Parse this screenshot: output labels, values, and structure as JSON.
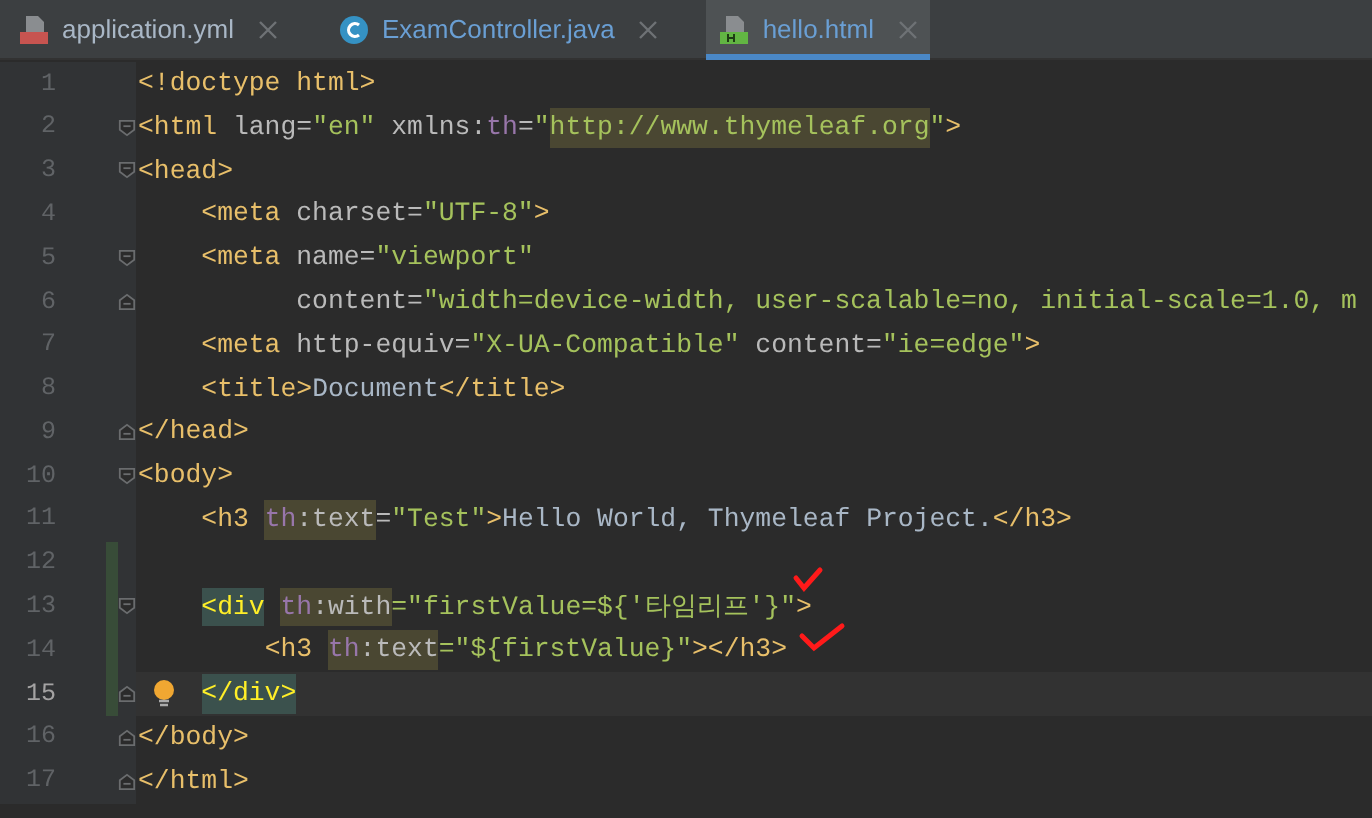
{
  "tabs": [
    {
      "label": "application.yml",
      "selected": false,
      "color": "#a9b7c6"
    },
    {
      "label": "ExamController.java",
      "selected": false,
      "color": "#6a9fd4"
    },
    {
      "label": "hello.html",
      "selected": true,
      "color": "#6a9fd4"
    }
  ],
  "editor": {
    "lines": [
      {
        "number": "1",
        "tokens": [
          {
            "kind": "tag",
            "text": "<!doctype html>"
          }
        ]
      },
      {
        "number": "2",
        "fold_start": true,
        "tokens": [
          {
            "kind": "tag",
            "text": "<html "
          },
          {
            "kind": "attr",
            "text": "lang="
          },
          {
            "kind": "value",
            "text": "\"en\" "
          },
          {
            "kind": "attr",
            "text": "xmlns:"
          },
          {
            "kind": "ns",
            "text": "th"
          },
          {
            "kind": "attr",
            "text": "="
          },
          {
            "kind": "value",
            "text": "\""
          },
          {
            "kind": "value",
            "text": "http://www.thymeleaf.org",
            "highlighted": true
          },
          {
            "kind": "value",
            "text": "\""
          },
          {
            "kind": "tag",
            "text": ">"
          }
        ]
      },
      {
        "number": "3",
        "fold_start": true,
        "tokens": [
          {
            "kind": "tag",
            "text": "<head>"
          }
        ]
      },
      {
        "number": "4",
        "tokens": [
          {
            "kind": "tag",
            "text": "    <meta "
          },
          {
            "kind": "attr",
            "text": "charset="
          },
          {
            "kind": "value",
            "text": "\"UTF-8\""
          },
          {
            "kind": "tag",
            "text": ">"
          }
        ]
      },
      {
        "number": "5",
        "fold_start": true,
        "tokens": [
          {
            "kind": "tag",
            "text": "    <meta "
          },
          {
            "kind": "attr",
            "text": "name="
          },
          {
            "kind": "value",
            "text": "\"viewport\""
          }
        ]
      },
      {
        "number": "6",
        "fold_end": true,
        "tokens": [
          {
            "kind": "attr",
            "text": "          content="
          },
          {
            "kind": "value",
            "text": "\"width=device-width, user-scalable=no, initial-scale=1.0, m"
          }
        ]
      },
      {
        "number": "7",
        "tokens": [
          {
            "kind": "tag",
            "text": "    <meta "
          },
          {
            "kind": "attr",
            "text": "http-equiv="
          },
          {
            "kind": "value",
            "text": "\"X-UA-Compatible\" "
          },
          {
            "kind": "attr",
            "text": "content="
          },
          {
            "kind": "value",
            "text": "\"ie=edge\""
          },
          {
            "kind": "tag",
            "text": ">"
          }
        ]
      },
      {
        "number": "8",
        "tokens": [
          {
            "kind": "tag",
            "text": "    <title>"
          },
          {
            "kind": "plain",
            "text": "Document"
          },
          {
            "kind": "tag",
            "text": "</title>"
          }
        ]
      },
      {
        "number": "9",
        "fold_end": true,
        "tokens": [
          {
            "kind": "tag",
            "text": "</head>"
          }
        ]
      },
      {
        "number": "10",
        "fold_start": true,
        "tokens": [
          {
            "kind": "tag",
            "text": "<body>"
          }
        ]
      },
      {
        "number": "11",
        "tokens": [
          {
            "kind": "tag",
            "text": "    <h3 "
          },
          {
            "kind": "ns",
            "text": "th",
            "highlighted": true
          },
          {
            "kind": "attr",
            "text": ":text",
            "highlighted": true
          },
          {
            "kind": "attr",
            "text": "="
          },
          {
            "kind": "value",
            "text": "\"Test\""
          },
          {
            "kind": "tag",
            "text": ">"
          },
          {
            "kind": "plain",
            "text": "Hello World, Thymeleaf Project."
          },
          {
            "kind": "tag",
            "text": "</h3>"
          }
        ]
      },
      {
        "number": "12",
        "changed": true
      },
      {
        "number": "13",
        "changed": true,
        "fold_start": true,
        "tokens": [
          {
            "kind": "tag",
            "text": "    <div",
            "matched": true
          },
          {
            "kind": "ns",
            "text": " th",
            "highlighted": true
          },
          {
            "kind": "attr",
            "text": ":with",
            "highlighted": true
          },
          {
            "kind": "value",
            "text": "=\"firstValue=${'타임리프'}\""
          },
          {
            "kind": "tag",
            "text": ">"
          }
        ]
      },
      {
        "number": "14",
        "changed": true,
        "tokens": [
          {
            "kind": "tag",
            "text": "        <h3 "
          },
          {
            "kind": "ns",
            "text": "th",
            "highlighted": true
          },
          {
            "kind": "attr",
            "text": ":text",
            "highlighted": true
          },
          {
            "kind": "value",
            "text": "=\"${firstValue}\""
          },
          {
            "kind": "tag",
            "text": "></h3>"
          }
        ]
      },
      {
        "number": "15",
        "changed": true,
        "current": true,
        "bulb": true,
        "fold_end": true,
        "tokens": [
          {
            "kind": "tag",
            "text": "    </div>",
            "matched": true
          }
        ]
      },
      {
        "number": "16",
        "fold_end": true,
        "tokens": [
          {
            "kind": "tag",
            "text": "</body>"
          }
        ]
      },
      {
        "number": "17",
        "fold_end": true,
        "tokens": [
          {
            "kind": "tag",
            "text": "</html>"
          }
        ]
      }
    ]
  }
}
